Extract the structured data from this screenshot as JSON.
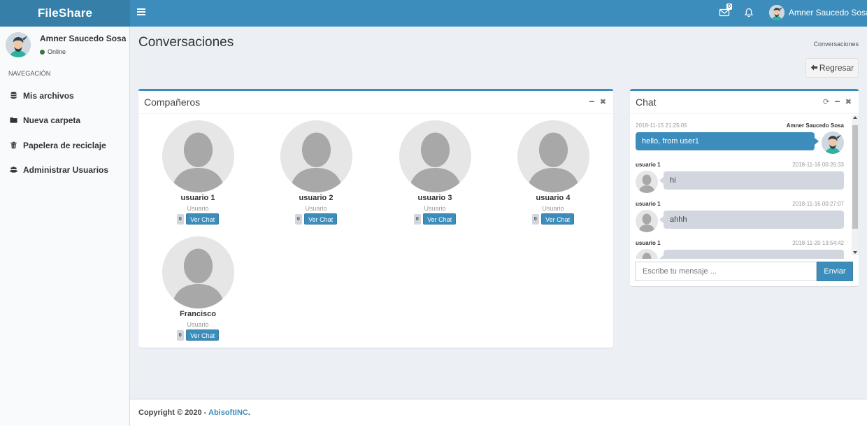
{
  "header": {
    "logo": "FileShare",
    "mail_count": "0",
    "username": "Amner Saucedo Sosa"
  },
  "sidebar": {
    "user_name": "Amner Saucedo Sosa",
    "status": "Online",
    "nav_header": "NAVEGACIÓN",
    "items": [
      {
        "label": "Mis archivos",
        "icon": "database-icon"
      },
      {
        "label": "Nueva carpeta",
        "icon": "folder-icon"
      },
      {
        "label": "Papelera de reciclaje",
        "icon": "trash-icon"
      },
      {
        "label": "Administrar Usuarios",
        "icon": "users-icon"
      }
    ]
  },
  "content": {
    "title": "Conversaciones",
    "breadcrumb": "Conversaciones",
    "back_label": "Regresar"
  },
  "companions": {
    "title": "Compañeros",
    "users": [
      {
        "name": "usuario 1",
        "role": "Usuario",
        "count": "0",
        "button": "Ver Chat"
      },
      {
        "name": "usuario 2",
        "role": "Usuario",
        "count": "0",
        "button": "Ver Chat"
      },
      {
        "name": "usuario 3",
        "role": "Usuario",
        "count": "0",
        "button": "Ver Chat"
      },
      {
        "name": "usuario 4",
        "role": "Usuario",
        "count": "0",
        "button": "Ver Chat"
      },
      {
        "name": "Francisco",
        "role": "Usuario",
        "count": "0",
        "button": "Ver Chat"
      }
    ]
  },
  "chat": {
    "title": "Chat",
    "messages": [
      {
        "name": "Amner Saucedo Sosa",
        "time": "2018-11-15 21:25:05",
        "text": "hello, from user1",
        "side": "right"
      },
      {
        "name": "usuario 1",
        "time": "2018-11-16 00:26:33",
        "text": "hi",
        "side": "left"
      },
      {
        "name": "usuario 1",
        "time": "2018-11-16 00:27:07",
        "text": "ahhh",
        "side": "left"
      },
      {
        "name": "usuario 1",
        "time": "2018-11-20 13:54:42",
        "text": "",
        "side": "left"
      }
    ],
    "placeholder": "Escribe tu mensaje ...",
    "send_label": "Enviar"
  },
  "footer": {
    "prefix": "Copyright © 2020 - ",
    "company": "AbisoftINC",
    "suffix": "."
  },
  "colors": {
    "primary": "#3c8dbc",
    "logo_bg": "#367fa9",
    "online": "#3c763d"
  }
}
